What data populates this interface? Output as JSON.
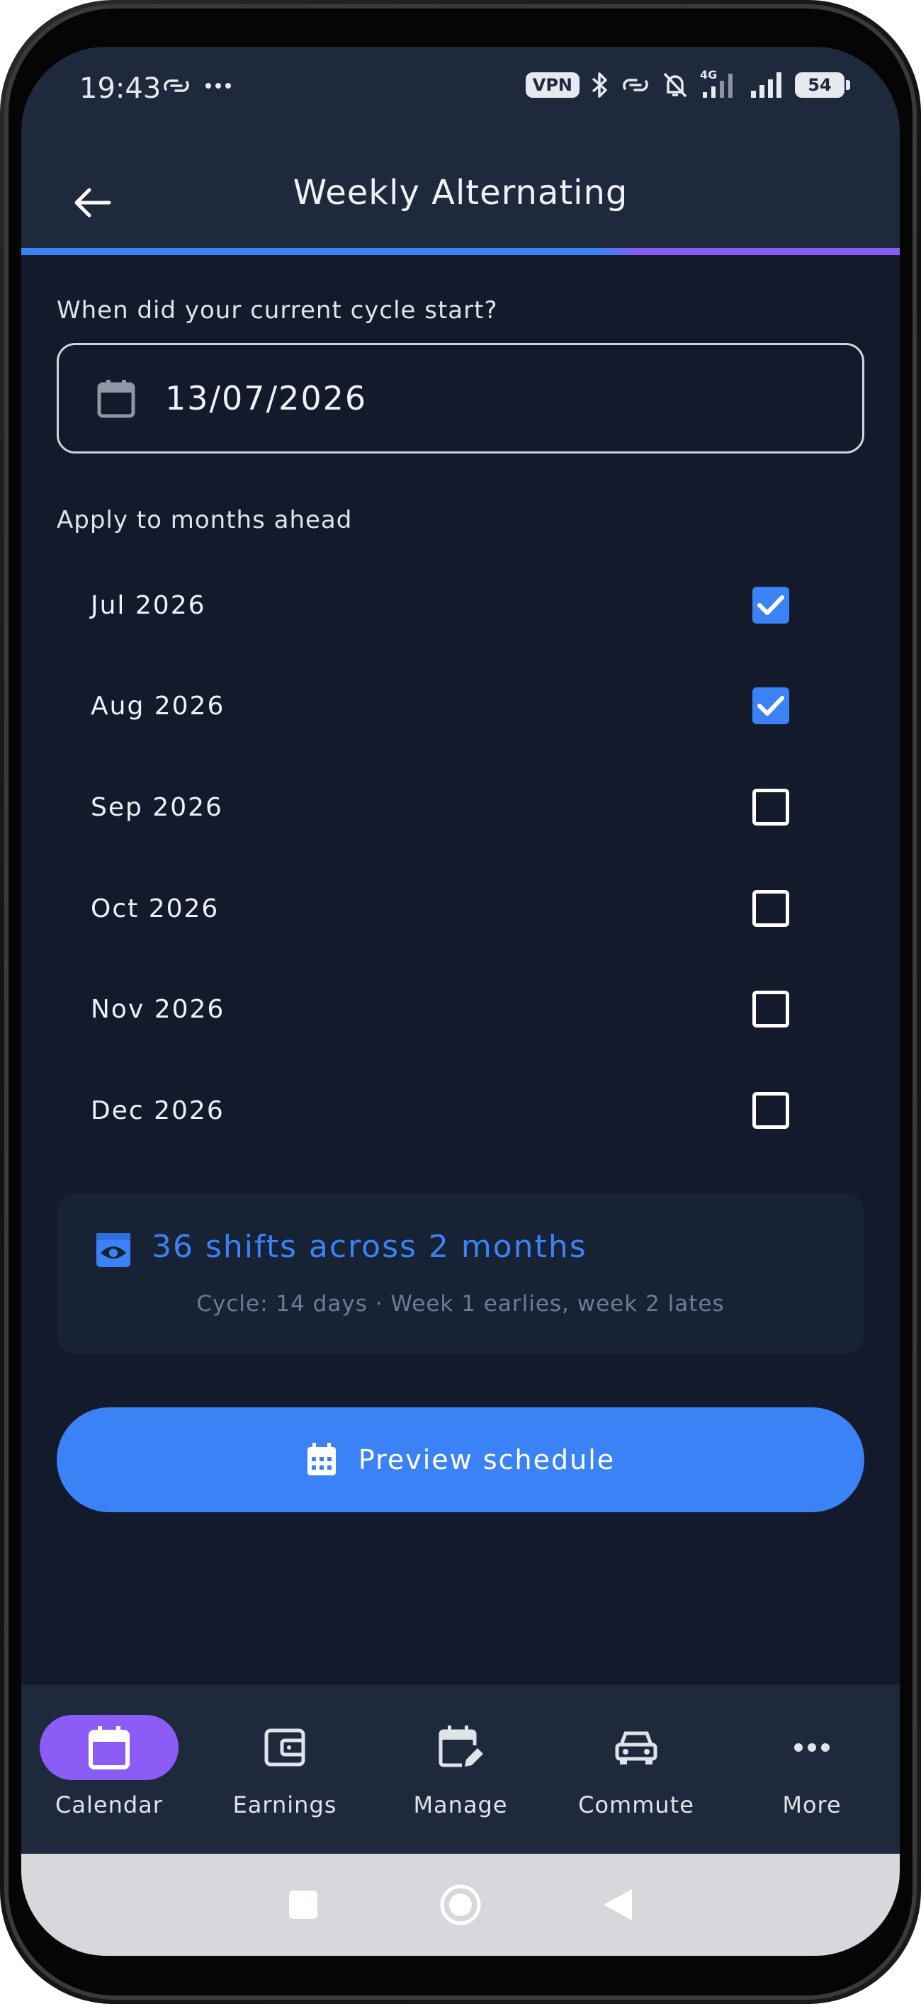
{
  "status_bar": {
    "time": "19:43",
    "vpn": "VPN",
    "network": "4G",
    "battery": "54"
  },
  "header": {
    "title": "Weekly Alternating"
  },
  "cycle": {
    "label": "When did your current cycle start?",
    "date": "13/07/2026"
  },
  "months": {
    "label": "Apply to months ahead",
    "items": [
      {
        "label": "Jul 2026",
        "checked": true
      },
      {
        "label": "Aug 2026",
        "checked": true
      },
      {
        "label": "Sep 2026",
        "checked": false
      },
      {
        "label": "Oct 2026",
        "checked": false
      },
      {
        "label": "Nov 2026",
        "checked": false
      },
      {
        "label": "Dec 2026",
        "checked": false
      }
    ]
  },
  "summary": {
    "title": "36 shifts across 2 months",
    "subtitle": "Cycle: 14 days · Week 1 earlies, week 2 lates"
  },
  "preview_button": {
    "label": "Preview schedule"
  },
  "bottom_nav": {
    "items": [
      {
        "label": "Calendar",
        "icon": "calendar-icon",
        "active": true
      },
      {
        "label": "Earnings",
        "icon": "wallet-icon",
        "active": false
      },
      {
        "label": "Manage",
        "icon": "calendar-edit-icon",
        "active": false
      },
      {
        "label": "Commute",
        "icon": "car-icon",
        "active": false
      },
      {
        "label": "More",
        "icon": "more-icon",
        "active": false
      }
    ]
  },
  "colors": {
    "accent": "#3b82f6",
    "active_nav": "#8b5cf6",
    "background": "#121a2b",
    "surface": "#1e293b"
  }
}
